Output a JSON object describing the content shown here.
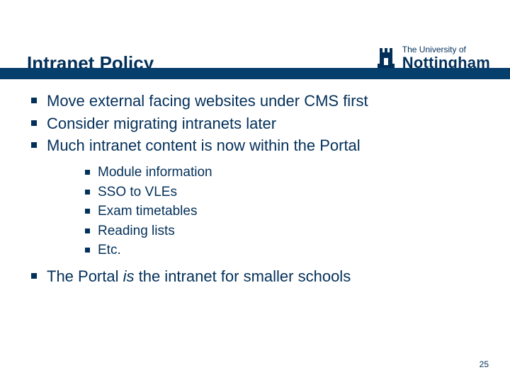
{
  "title": "Intranet Policy",
  "logo": {
    "line1": "The University of",
    "line2": "Nottingham"
  },
  "bullets": {
    "b1": "Move external facing websites under CMS first",
    "b2": "Consider migrating intranets later",
    "b3": "Much intranet content is now within the Portal",
    "sub": {
      "s1": "Module information",
      "s2": "SSO to VLEs",
      "s3": "Exam timetables",
      "s4": "Reading lists",
      "s5": "Etc."
    },
    "b4_pre": "The Portal ",
    "b4_em": "is",
    "b4_post": " the intranet for smaller schools"
  },
  "page_number": "25"
}
